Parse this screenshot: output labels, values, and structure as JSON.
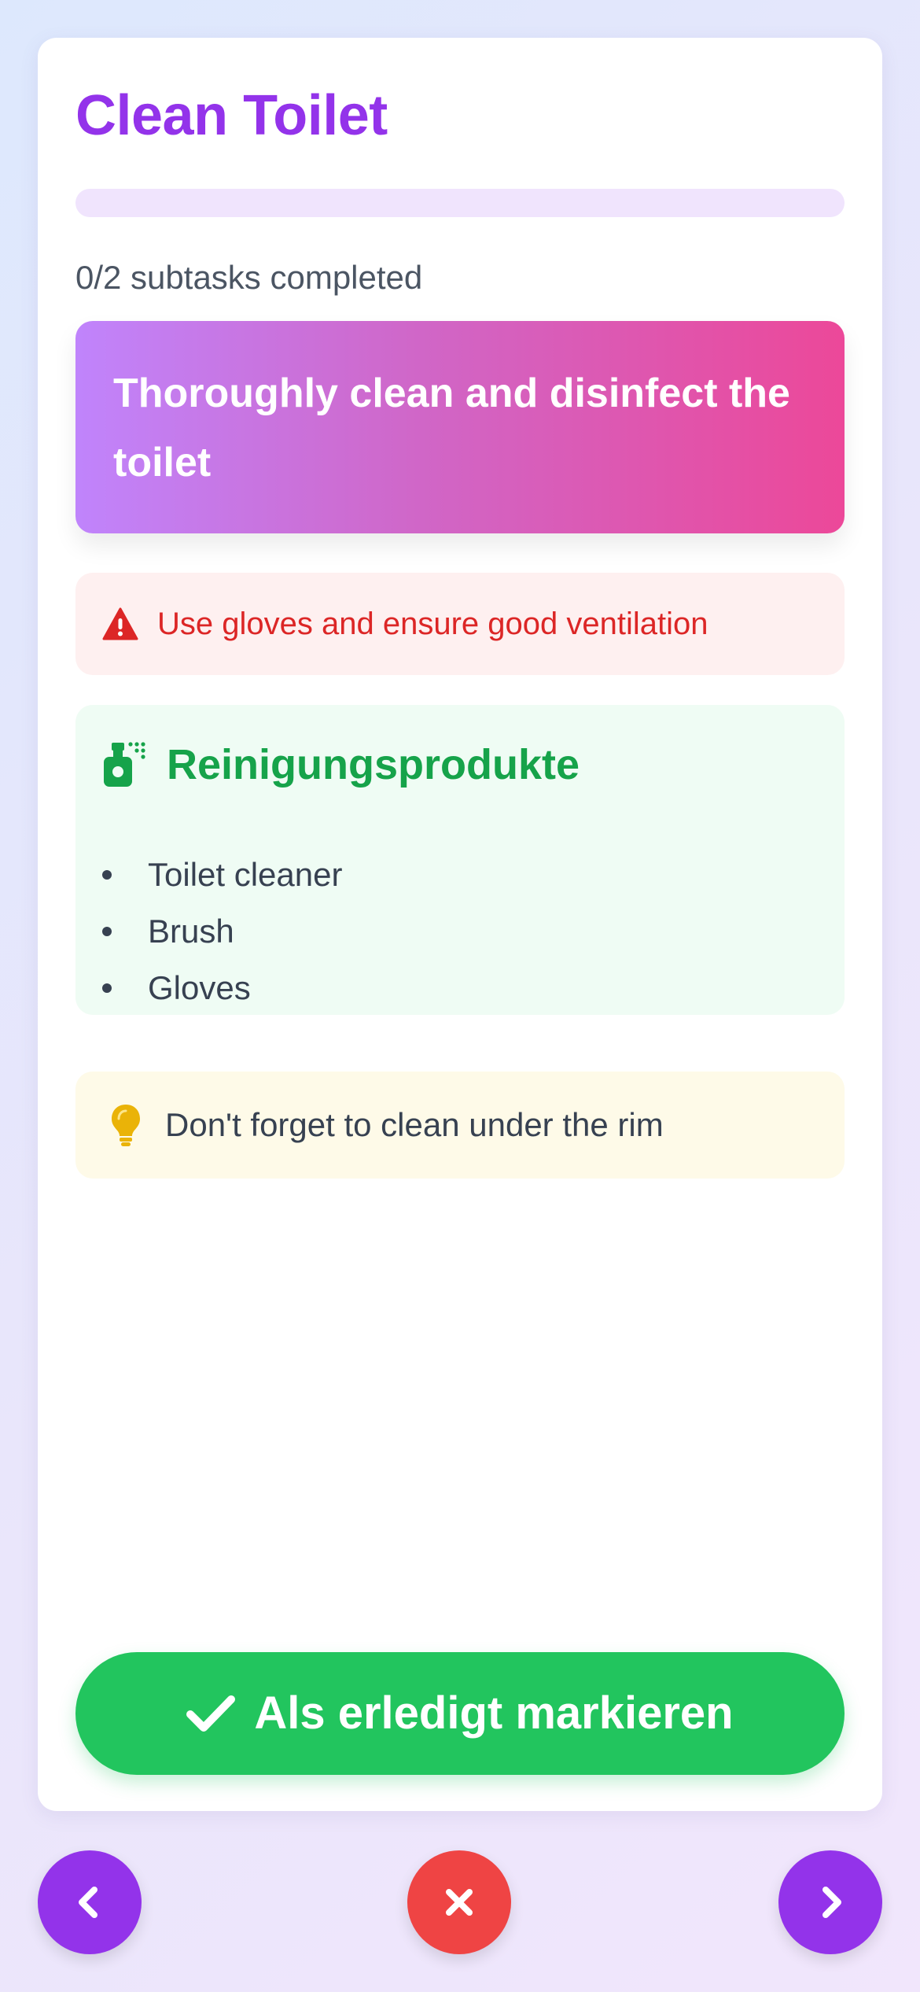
{
  "task": {
    "title": "Clean Toilet",
    "progress_text": "0/2 subtasks completed",
    "progress_fraction": 0,
    "description": "Thoroughly clean and disinfect the toilet"
  },
  "warning": {
    "icon": "warning-triangle-icon",
    "text": "Use gloves and ensure good ventilation"
  },
  "products": {
    "icon": "spray-bottle-icon",
    "title": "Reinigungsprodukte",
    "items": [
      "Toilet cleaner",
      "Brush",
      "Gloves"
    ]
  },
  "tip": {
    "icon": "lightbulb-icon",
    "text": "Don't forget to clean under the rim"
  },
  "actions": {
    "done_label": "Als erledigt markieren",
    "done_icon": "check-icon"
  },
  "navigation": {
    "prev_icon": "chevron-left-icon",
    "close_icon": "close-icon",
    "next_icon": "chevron-right-icon"
  },
  "colors": {
    "accent": "#9333ea",
    "success": "#22c55e",
    "danger": "#ef4444",
    "warning_text": "#dc2626",
    "products_title": "#16a34a",
    "tip_icon": "#eab308"
  }
}
